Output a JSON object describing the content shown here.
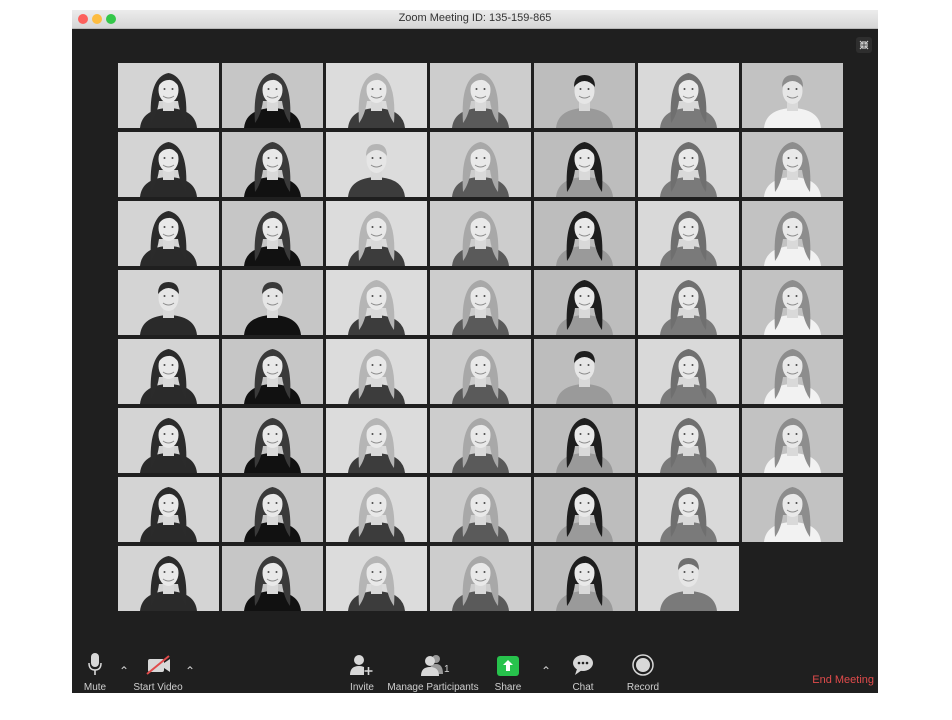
{
  "window": {
    "title": "Zoom Meeting ID: 135-159-865",
    "traffic_lights": [
      "#fc605c",
      "#fdbc40",
      "#34c749"
    ]
  },
  "toolbar": {
    "mute_label": "Mute",
    "start_video_label": "Start Video",
    "invite_label": "Invite",
    "manage_participants_label": "Manage Participants",
    "participant_count": "1",
    "share_label": "Share",
    "chat_label": "Chat",
    "record_label": "Record",
    "end_meeting_label": "End Meeting",
    "share_color": "#27c24c",
    "end_color": "#e04b4b"
  },
  "gallery": {
    "rows": [
      [
        "f",
        "f",
        "f",
        "f",
        "m",
        "f",
        "m"
      ],
      [
        "f",
        "f",
        "m",
        "f",
        "f",
        "f",
        "f"
      ],
      [
        "f",
        "f",
        "f",
        "f",
        "f",
        "f",
        "f"
      ],
      [
        "m",
        "m",
        "f",
        "f",
        "f",
        "f",
        "f"
      ],
      [
        "f",
        "f",
        "f",
        "f",
        "m",
        "f",
        "f"
      ],
      [
        "f",
        "f",
        "f",
        "f",
        "f",
        "f",
        "f"
      ],
      [
        "f",
        "f",
        "f",
        "f",
        "f",
        "f",
        "f"
      ],
      [
        "f",
        "f",
        "f",
        "f",
        "f",
        "m"
      ]
    ]
  }
}
